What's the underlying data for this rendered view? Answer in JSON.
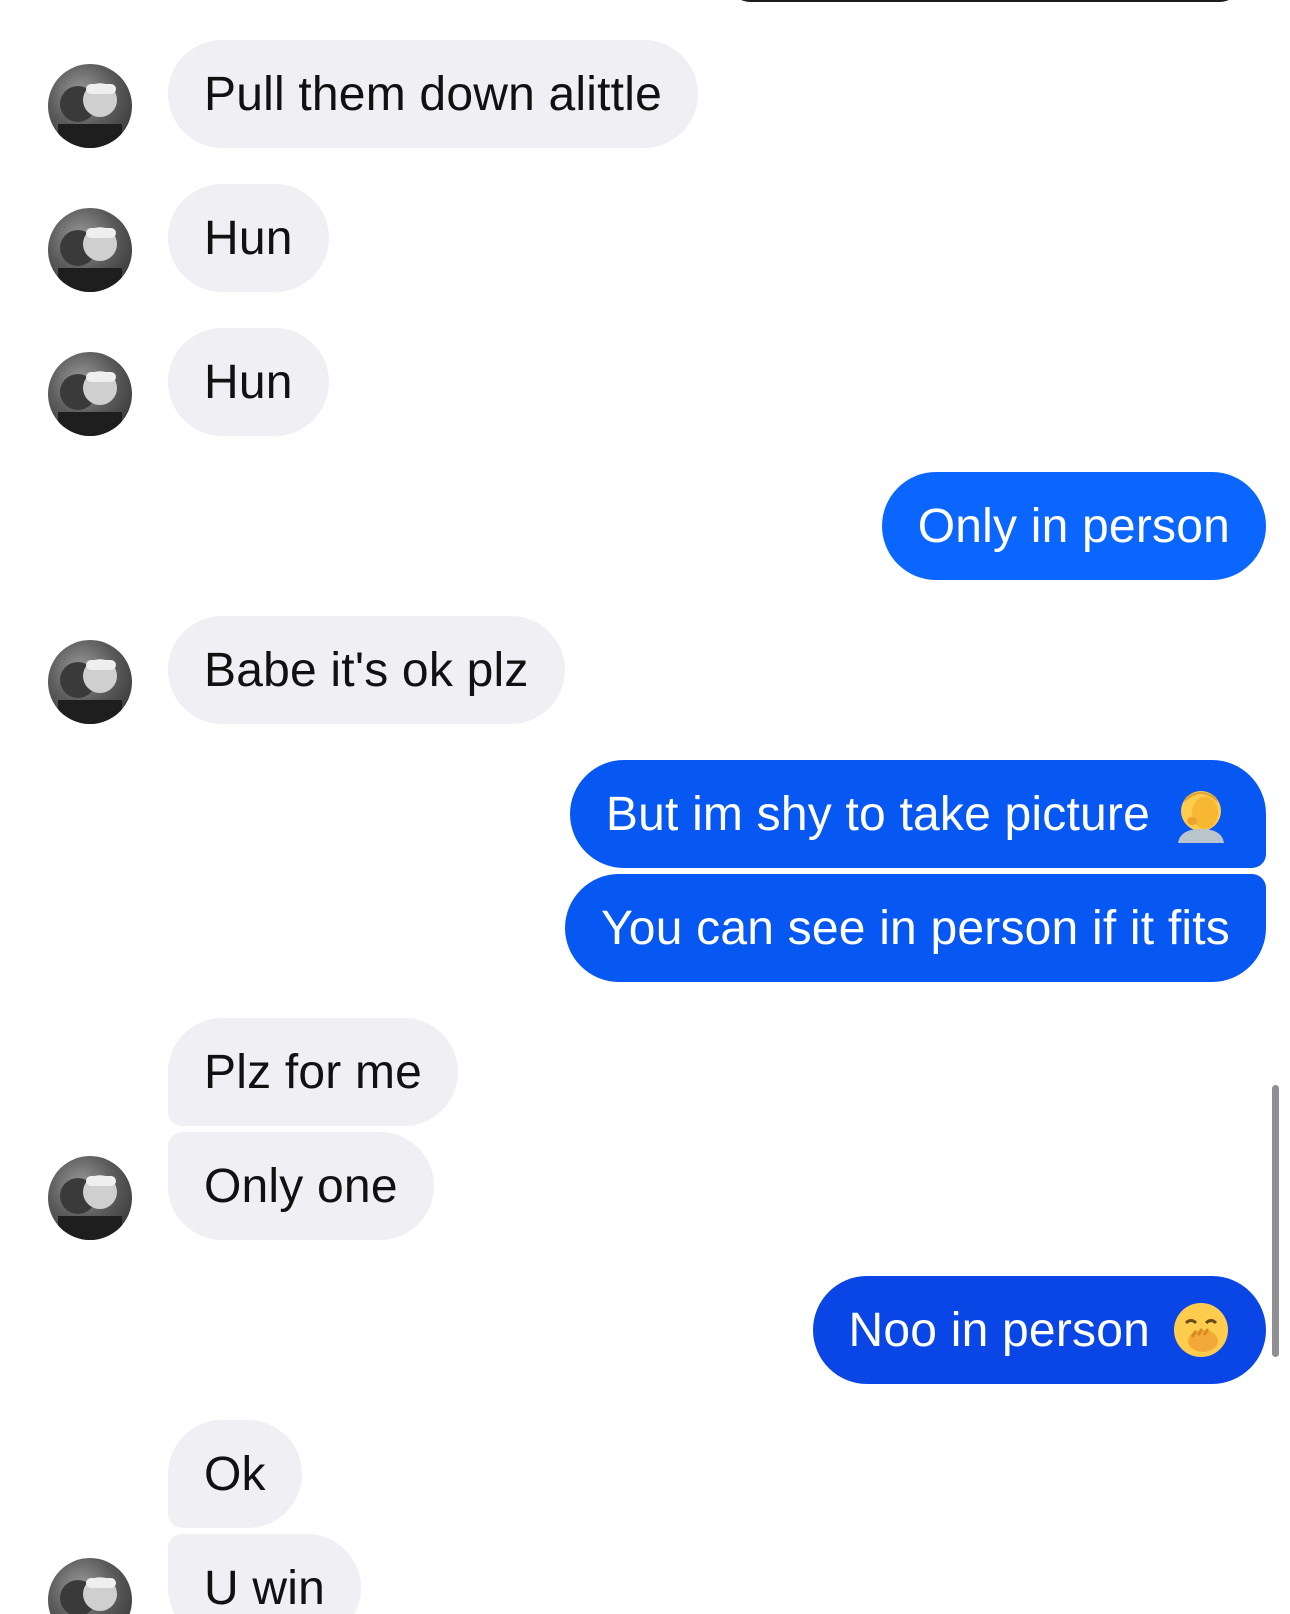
{
  "conversation": {
    "messages": [
      {
        "text": "Pull them down alittle"
      },
      {
        "text": "Hun"
      },
      {
        "text": "Hun"
      },
      {
        "text": "Only in person"
      },
      {
        "text": "Babe it's ok plz"
      },
      {
        "text": "But im shy to take picture",
        "emoji": "face-palm-icon"
      },
      {
        "text": "You can see in person if it fits"
      },
      {
        "text": "Plz for me"
      },
      {
        "text": "Only one"
      },
      {
        "text": "Noo in person",
        "emoji": "hand-over-mouth-icon"
      },
      {
        "text": "Ok"
      },
      {
        "text": "U win"
      }
    ]
  },
  "theme": {
    "incoming_bubble": "#f0f0f4",
    "outgoing_bubble": "#0a66ff",
    "outgoing_bubble_deep": "#0a45e6",
    "scrollbar": "#8e8e93"
  }
}
